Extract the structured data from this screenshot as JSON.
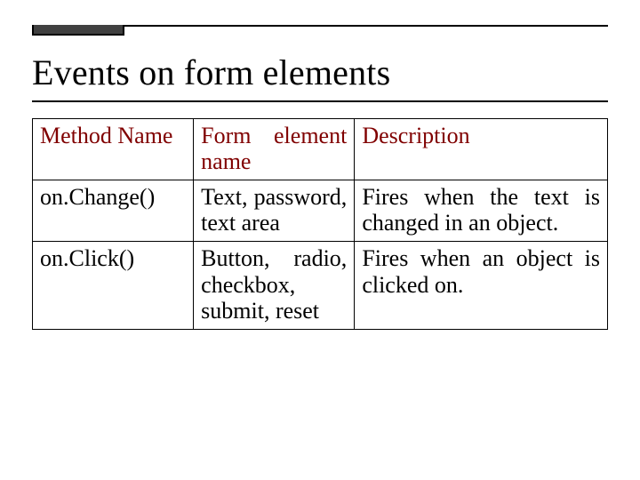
{
  "title": "Events on form elements",
  "table": {
    "header": {
      "col1": "Method Name",
      "col2": "Form element name",
      "col3": "Description"
    },
    "rows": [
      {
        "col1": "on.Change()",
        "col2": "Text, password, text area",
        "col3": "Fires when the text is changed in an object."
      },
      {
        "col1": "on.Click()",
        "col2": "Button, radio, checkbox, submit, reset",
        "col3": "Fires when an object is clicked on."
      }
    ]
  },
  "chart_data": {
    "type": "table",
    "columns": [
      "Method Name",
      "Form element name",
      "Description"
    ],
    "rows": [
      [
        "on.Change()",
        "Text, password, text area",
        "Fires when the text is changed in an object."
      ],
      [
        "on.Click()",
        "Button, radio, checkbox, submit, reset",
        "Fires when an object is clicked on."
      ]
    ]
  }
}
